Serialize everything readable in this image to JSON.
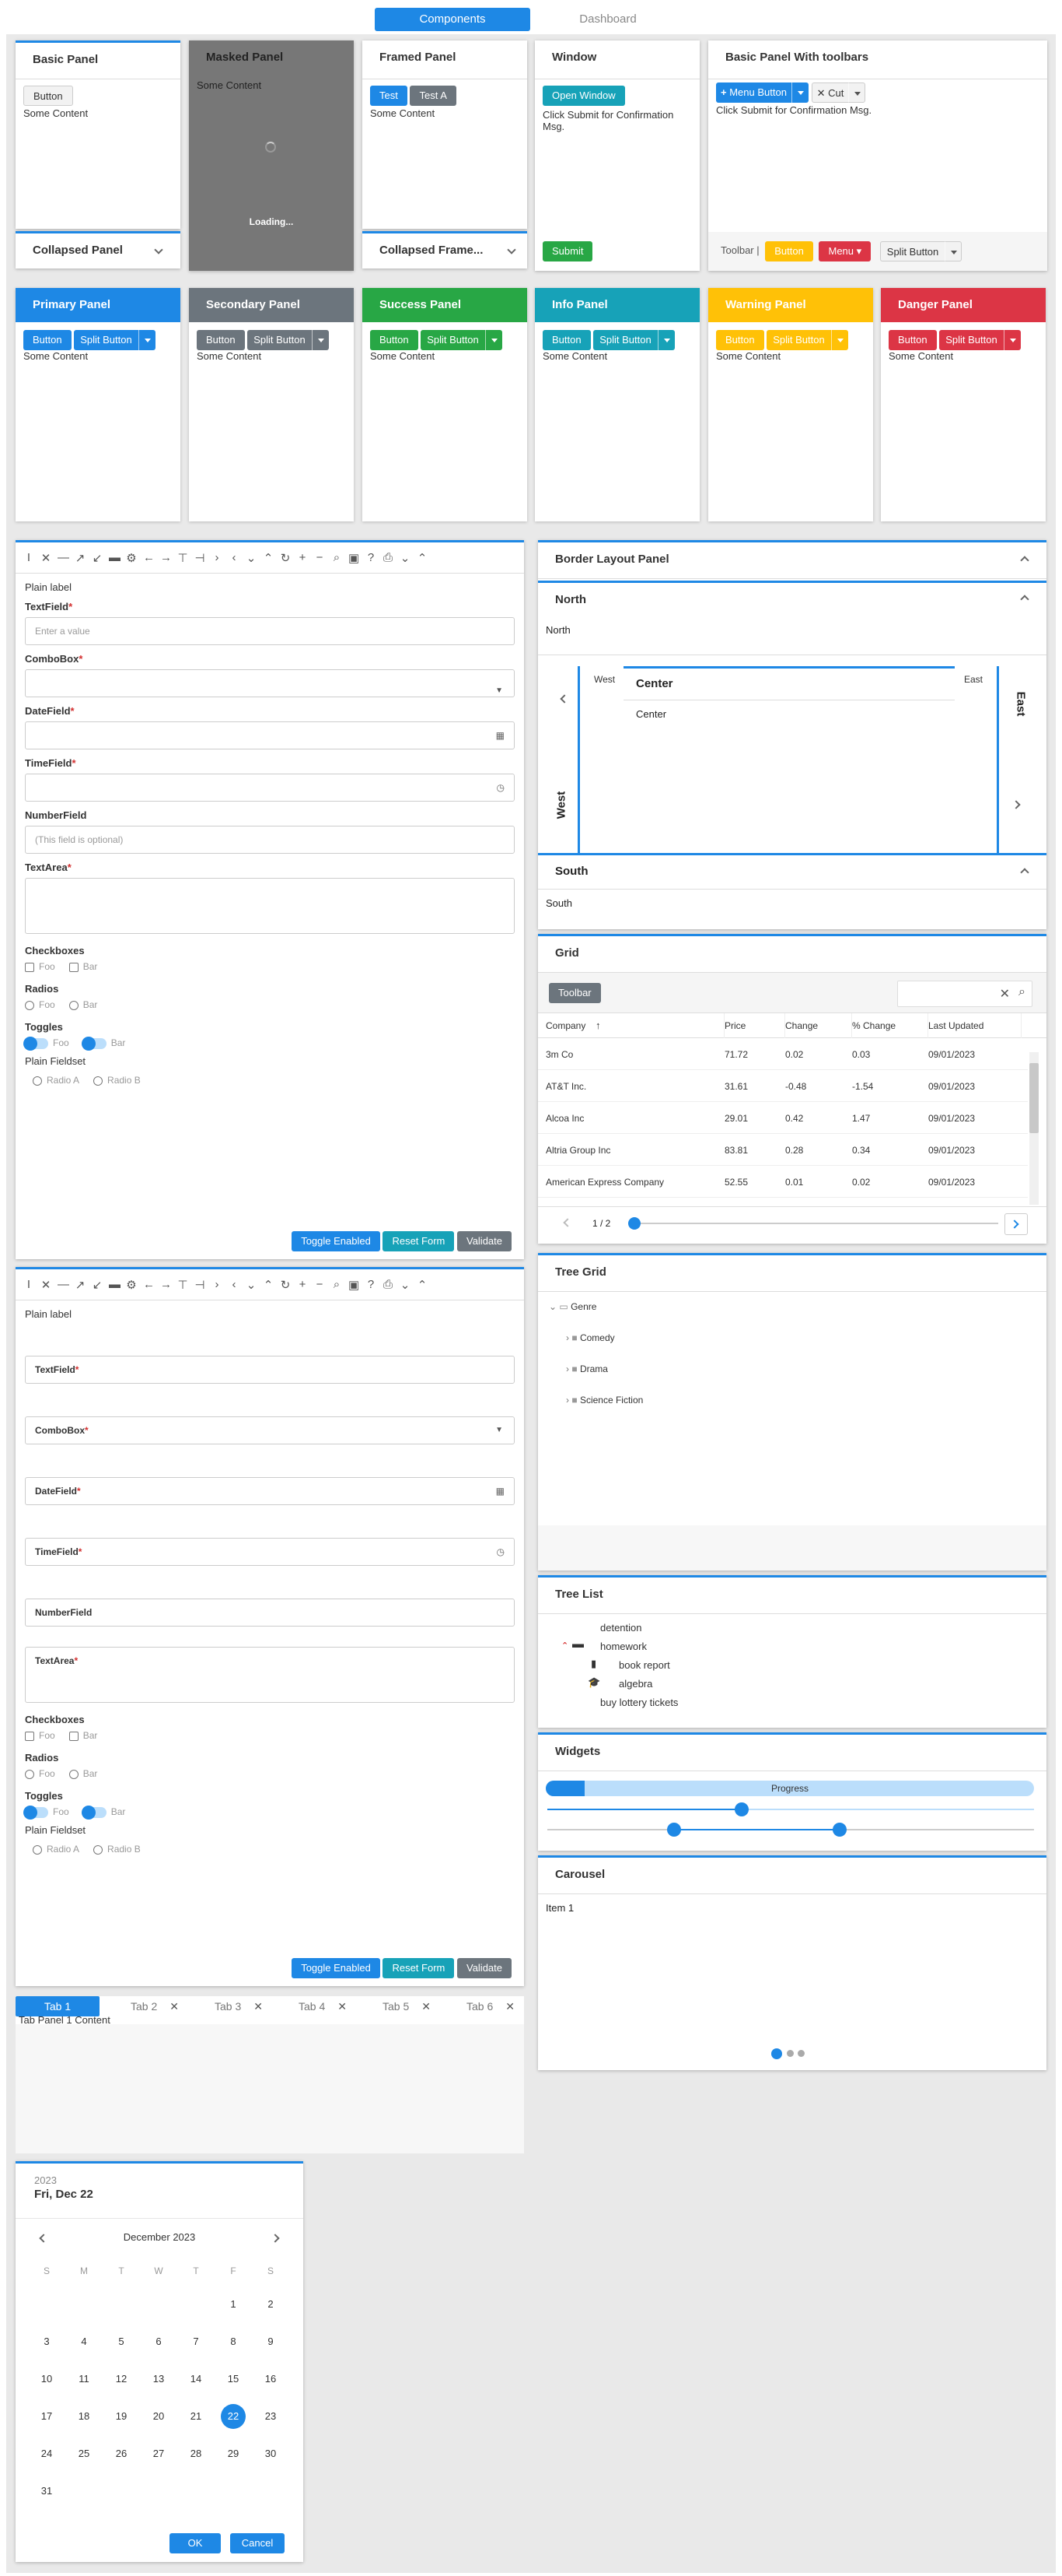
{
  "topnav": {
    "tabs": [
      "Components",
      "Dashboard"
    ],
    "active": "Components"
  },
  "row1": {
    "basic": {
      "title": "Basic Panel",
      "button": "Button",
      "content": "Some Content",
      "collapsed": "Collapsed Panel"
    },
    "masked": {
      "title": "Masked Panel",
      "content": "Some Content",
      "loading": "Loading..."
    },
    "framed": {
      "title": "Framed Panel",
      "btn1": "Test",
      "btn2": "Test A",
      "content": "Some Content",
      "collapsed": "Collapsed Frame..."
    },
    "window": {
      "title": "Window",
      "open": "Open Window",
      "msg": "Click Submit for Confirmation Msg.",
      "submit": "Submit"
    },
    "toolbars": {
      "title": "Basic Panel With toolbars",
      "menu_button": "Menu Button",
      "cut": "Cut",
      "msg": "Click Submit for Confirmation Msg.",
      "footer_label": "Toolbar |",
      "button": "Button",
      "menu": "Menu",
      "split": "Split Button"
    }
  },
  "color_panels": [
    {
      "title": "Primary Panel",
      "button": "Button",
      "split": "Split Button",
      "content": "Some Content",
      "color": "#1e88e5"
    },
    {
      "title": "Secondary Panel",
      "button": "Button",
      "split": "Split Button",
      "content": "Some Content",
      "color": "#6c757d"
    },
    {
      "title": "Success Panel",
      "button": "Button",
      "split": "Split Button",
      "content": "Some Content",
      "color": "#28a745"
    },
    {
      "title": "Info Panel",
      "button": "Button",
      "split": "Split Button",
      "content": "Some Content",
      "color": "#17a2b8"
    },
    {
      "title": "Warning Panel",
      "button": "Button",
      "split": "Split Button",
      "content": "Some Content",
      "color": "#ffc107"
    },
    {
      "title": "Danger Panel",
      "button": "Button",
      "split": "Split Button",
      "content": "Some Content",
      "color": "#dc3545"
    }
  ],
  "form": {
    "plain_label": "Plain label",
    "textfield": "TextField",
    "textfield_placeholder": "Enter a value",
    "combobox": "ComboBox",
    "datefield": "DateField",
    "timefield": "TimeField",
    "numberfield": "NumberField",
    "numberfield_placeholder": "(This field is optional)",
    "textarea": "TextArea",
    "checkboxes": "Checkboxes",
    "radios": "Radios",
    "toggles": "Toggles",
    "fieldset": "Plain Fieldset",
    "foo": "Foo",
    "bar": "Bar",
    "radio_a": "Radio A",
    "radio_b": "Radio B",
    "toggle_enabled": "Toggle Enabled",
    "reset": "Reset Form",
    "validate": "Validate",
    "required_mark": "*"
  },
  "border_layout": {
    "title": "Border Layout Panel",
    "north": "North",
    "north_content": "North",
    "west": "West",
    "west_label": "West",
    "center": "Center",
    "center_content": "Center",
    "east": "East",
    "east_label": "East",
    "south": "South",
    "south_content": "South"
  },
  "grid": {
    "title": "Grid",
    "toolbar_button": "Toolbar",
    "columns": [
      "Company",
      "Price",
      "Change",
      "% Change",
      "Last Updated"
    ],
    "rows": [
      [
        "3m Co",
        "71.72",
        "0.02",
        "0.03",
        "09/01/2023"
      ],
      [
        "AT&T Inc.",
        "31.61",
        "-0.48",
        "-1.54",
        "09/01/2023"
      ],
      [
        "Alcoa Inc",
        "29.01",
        "0.42",
        "1.47",
        "09/01/2023"
      ],
      [
        "Altria Group Inc",
        "83.81",
        "0.28",
        "0.34",
        "09/01/2023"
      ],
      [
        "American Express Company",
        "52.55",
        "0.01",
        "0.02",
        "09/01/2023"
      ]
    ],
    "pager": "1 / 2"
  },
  "tree_grid": {
    "title": "Tree Grid",
    "root": "Genre",
    "children": [
      "Comedy",
      "Drama",
      "Science Fiction"
    ]
  },
  "tree_list": {
    "title": "Tree List",
    "items": [
      "detention",
      "homework",
      "book report",
      "algebra",
      "buy lottery tickets"
    ]
  },
  "widgets": {
    "title": "Widgets",
    "progress_label": "Progress",
    "progress": 0.08,
    "slider1": 0.4,
    "range": [
      0.26,
      0.6
    ]
  },
  "carousel": {
    "title": "Carousel",
    "item": "Item 1"
  },
  "tabs": {
    "labels": [
      "Tab 1",
      "Tab 2",
      "Tab 3",
      "Tab 4",
      "Tab 5",
      "Tab 6"
    ],
    "content": "Tab Panel 1 Content"
  },
  "calendar": {
    "year": "2023",
    "date_title": "Fri, Dec 22",
    "month": "December 2023",
    "weekdays": [
      "S",
      "M",
      "T",
      "W",
      "T",
      "F",
      "S"
    ],
    "selected": "22",
    "ok": "OK",
    "cancel": "Cancel"
  }
}
